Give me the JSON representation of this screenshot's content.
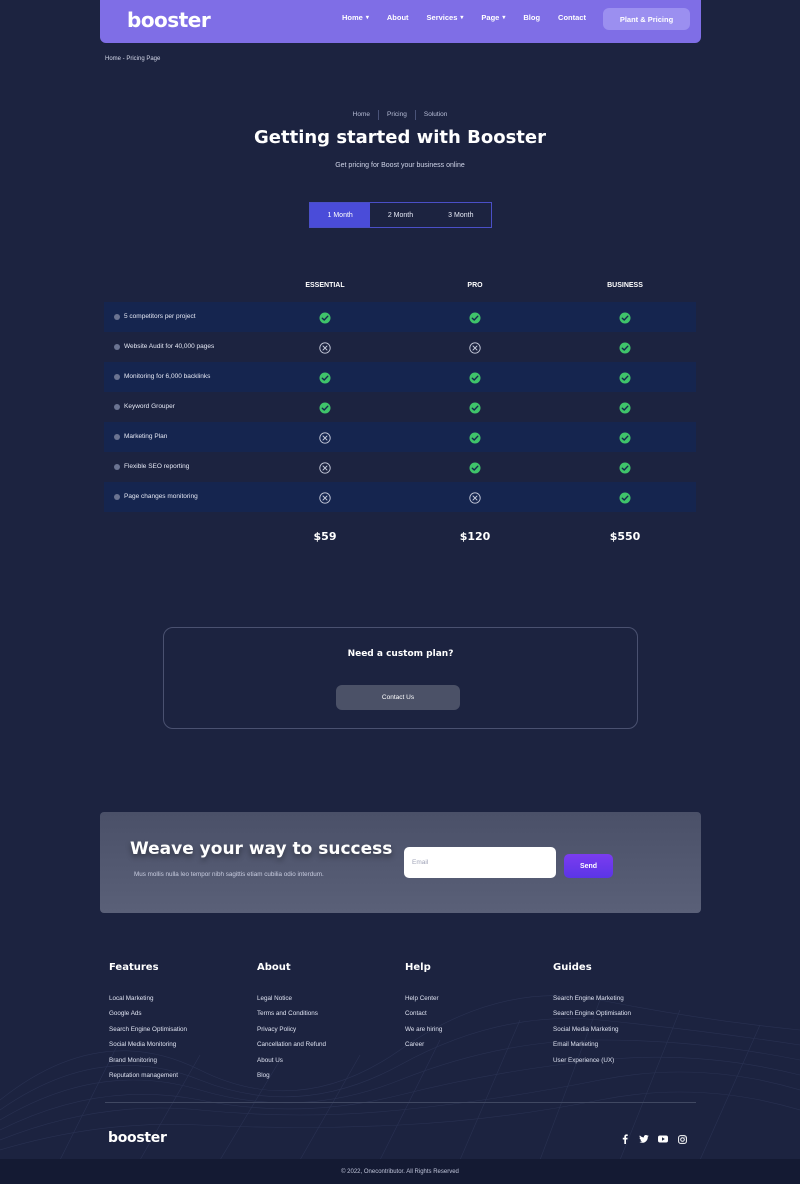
{
  "header": {
    "logo": "booster",
    "nav": [
      {
        "label": "Home",
        "caret": true
      },
      {
        "label": "About",
        "caret": false
      },
      {
        "label": "Services",
        "caret": true
      },
      {
        "label": "Page",
        "caret": true
      },
      {
        "label": "Blog",
        "caret": false
      },
      {
        "label": "Contact",
        "caret": false
      }
    ],
    "cta": "Plant & Pricing"
  },
  "breadcrumb": "Home - Pricing Page",
  "hero": {
    "crumbs": [
      "Home",
      "Pricing",
      "Solution"
    ],
    "title": "Getting started with Booster",
    "subtitle": "Get pricing for Boost your business online"
  },
  "period_toggle": {
    "options": [
      "1 Month",
      "2 Month",
      "3 Month"
    ],
    "selected": "1 Month"
  },
  "pricing": {
    "plans": [
      "ESSENTIAL",
      "PRO",
      "BUSINESS"
    ],
    "features": [
      {
        "name": "5 competitors per project",
        "included": [
          true,
          true,
          true
        ]
      },
      {
        "name": "Website Audit for 40,000 pages",
        "included": [
          false,
          false,
          true
        ]
      },
      {
        "name": "Monitoring for 6,000 backlinks",
        "included": [
          true,
          true,
          true
        ]
      },
      {
        "name": "Keyword Grouper",
        "included": [
          true,
          true,
          true
        ]
      },
      {
        "name": "Marketing Plan",
        "included": [
          false,
          true,
          true
        ]
      },
      {
        "name": "Flexible SEO reporting",
        "included": [
          false,
          true,
          true
        ]
      },
      {
        "name": "Page changes monitoring",
        "included": [
          false,
          false,
          true
        ]
      }
    ],
    "prices": [
      "$59",
      "$120",
      "$550"
    ]
  },
  "custom_plan": {
    "title": "Need a custom plan?",
    "button": "Contact Us"
  },
  "newsletter": {
    "title": "Weave your way to success",
    "text": "Mus mollis nulla leo tempor nibh sagittis etiam cubilia odio interdum.",
    "email_placeholder": "Email",
    "button": "Send"
  },
  "footer": {
    "columns": [
      {
        "title": "Features",
        "links": [
          "Local Marketing",
          "Google Ads",
          "Search Engine Optimisation",
          "Social Media Monitoring",
          "Brand Monitoring",
          "Reputation management"
        ]
      },
      {
        "title": "About",
        "links": [
          "Legal Notice",
          "Terms and Conditions",
          "Privacy Policy",
          "Cancellation and Refund",
          "About Us",
          "Blog"
        ]
      },
      {
        "title": "Help",
        "links": [
          "Help Center",
          "Contact",
          "We are hiring",
          "Career"
        ]
      },
      {
        "title": "Guides",
        "links": [
          "Search Engine Marketing",
          "Search Engine Optimisation",
          "Social Media Marketing",
          "Email Marketing",
          "User Experience (UX)"
        ]
      }
    ],
    "logo": "booster",
    "socials": [
      "facebook-icon",
      "twitter-icon",
      "youtube-icon",
      "instagram-icon"
    ],
    "copyright": "© 2022, Onecontributor. All Rights Reserved"
  },
  "colors": {
    "background": "#1c2340",
    "navbar": "#7f6ee6",
    "accent": "#4a4cd9",
    "check": "#3fc46a",
    "row_shade": "#15254f"
  }
}
